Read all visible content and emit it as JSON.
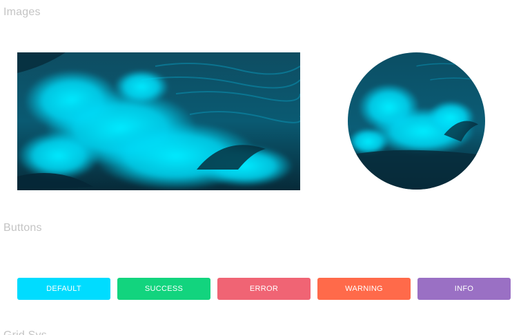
{
  "sections": {
    "images_title": "Images",
    "buttons_title": "Buttons",
    "next_title": "Grid Sys"
  },
  "buttons": [
    {
      "label": "DEFAULT",
      "color": "#00dcff"
    },
    {
      "label": "SUCCESS",
      "color": "#12d47e"
    },
    {
      "label": "ERROR",
      "color": "#f06474"
    },
    {
      "label": "WARNING",
      "color": "#ff6a4a"
    },
    {
      "label": "INFO",
      "color": "#9a70c4"
    }
  ],
  "colors": {
    "section_title": "#c4c4c4",
    "wave_dark": "#0a2c3c",
    "wave_mid": "#0a6f8a",
    "wave_bright": "#00e2ff"
  }
}
